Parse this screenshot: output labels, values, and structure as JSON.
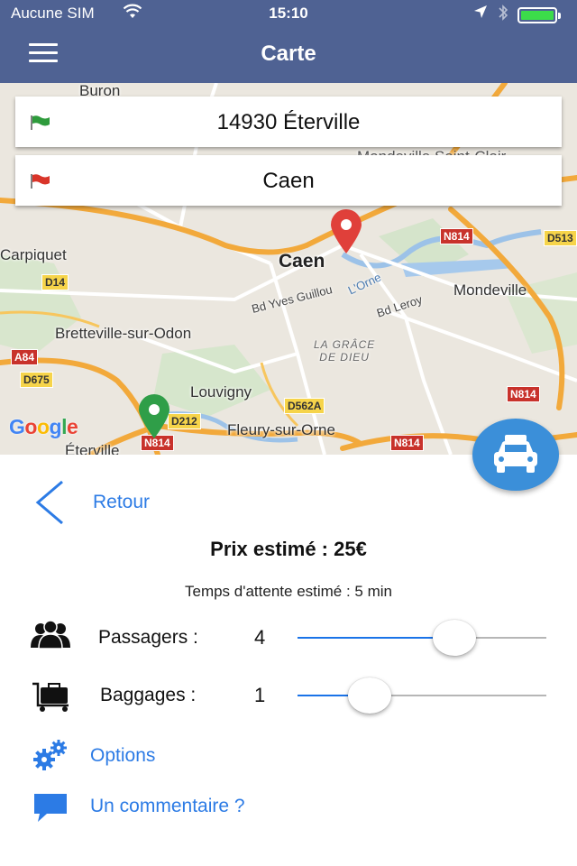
{
  "status_bar": {
    "carrier": "Aucune SIM",
    "time": "15:10",
    "battery_fraction": 1.0,
    "battery_color": "#3cdc4a"
  },
  "nav": {
    "title": "Carte",
    "menu_icon": "hamburger-menu-icon",
    "bar_color": "#4f6293"
  },
  "route": {
    "start": {
      "label": "14930 Éterville",
      "flag_color": "#2e9b3c"
    },
    "destination": {
      "label": "Caen",
      "flag_color": "#d9352a"
    }
  },
  "map": {
    "places": {
      "buron": "Buron",
      "carpiquet": "Carpiquet",
      "caen": "Caen",
      "mondeville": "Mondeville",
      "bretteville": "Bretteville-sur-Odon",
      "louvigny": "Louvigny",
      "fleury": "Fleury-sur-Orne",
      "eterville": "Éterville",
      "grace_line1": "LA GRÂCE",
      "grace_line2": "DE DIEU",
      "street_gullou": "Bd Yves Guillou",
      "street_leroy": "Bd Leroy",
      "river": "L'Orne",
      "cropped_top_right": "Mondeville Saint-Clair"
    },
    "shields": {
      "d14": "D14",
      "a84": "A84",
      "d675": "D675",
      "d212": "D212",
      "d562a": "D562A",
      "n814_a": "N814",
      "n814_b": "N814",
      "n814_c": "N814",
      "n814_d": "N814",
      "d513": "D513"
    },
    "logo": "Google",
    "markers": {
      "start_color": "#2f9e48",
      "destination_color": "#e0403a"
    }
  },
  "panel": {
    "back_label": "Retour",
    "price": "Prix estimé : 25€",
    "wait": "Temps d'attente estimé : 5 min",
    "passengers": {
      "label": "Passagers :",
      "value": "4",
      "slider_fraction": 0.63
    },
    "luggage": {
      "label": "Baggages :",
      "value": "1",
      "slider_fraction": 0.29
    },
    "options_label": "Options",
    "comment_label": "Un commentaire ?",
    "accent_color": "#2c7be5"
  }
}
